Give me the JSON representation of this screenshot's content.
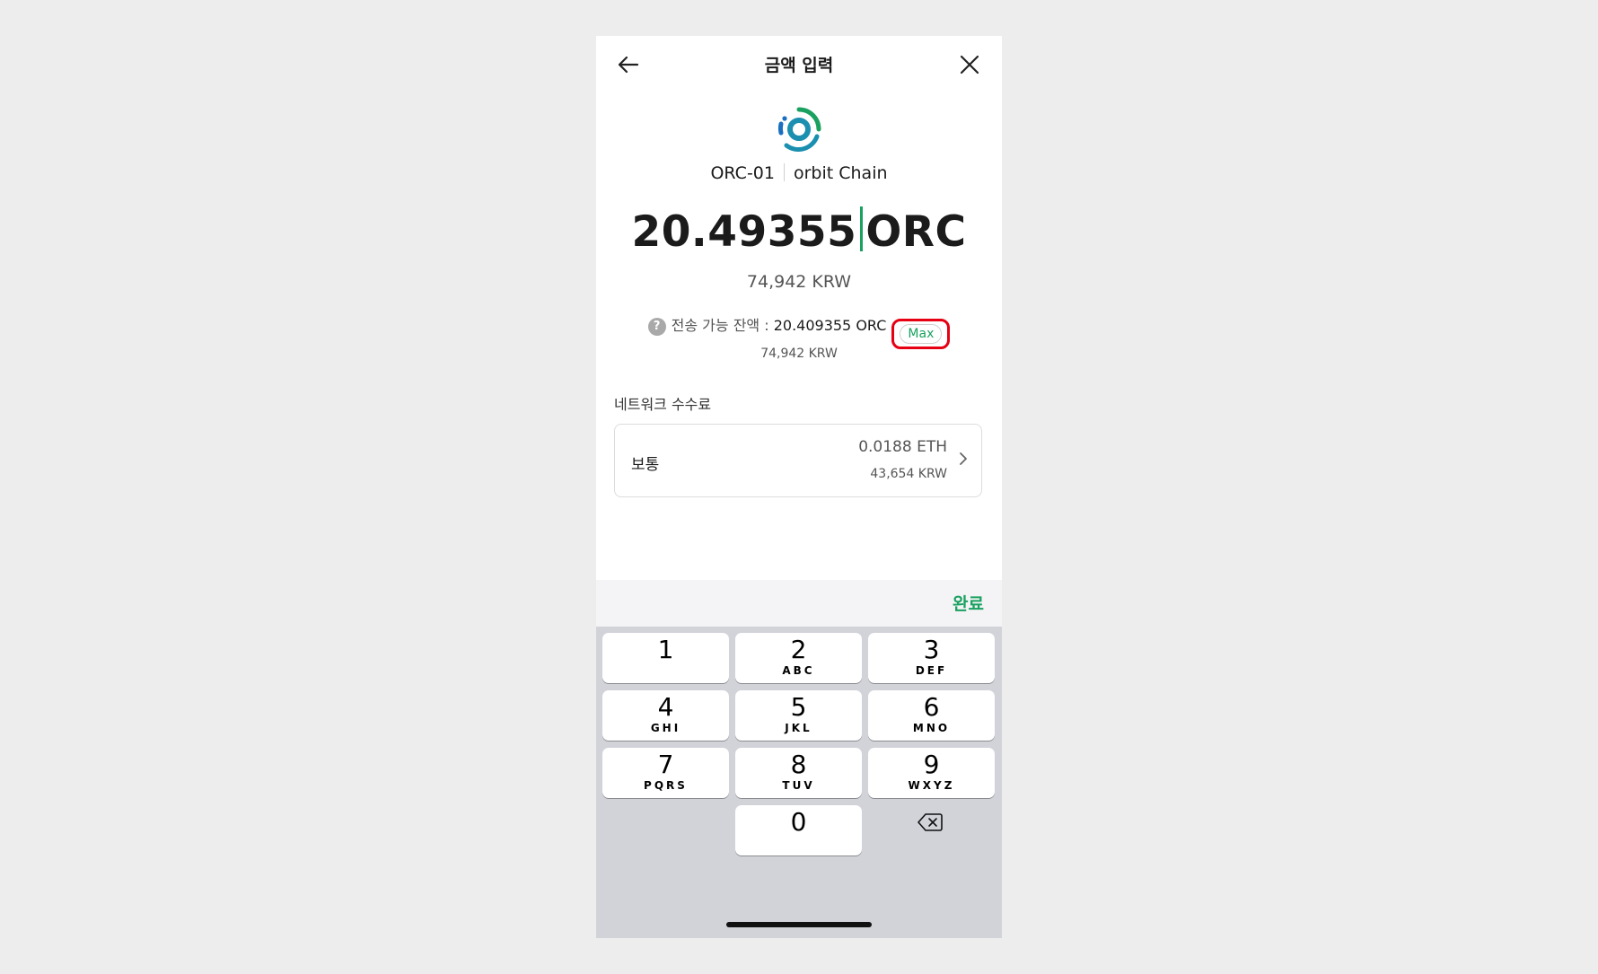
{
  "header": {
    "title": "금액 입력"
  },
  "token": {
    "symbol_name": "ORC-01",
    "chain": "orbit Chain"
  },
  "amount": {
    "value": "20.49355",
    "unit": "ORC",
    "krw": "74,942 KRW"
  },
  "available": {
    "help_glyph": "?",
    "label": "전송 가능 잔액 : ",
    "value": "20.409355 ORC",
    "max_label": "Max",
    "krw": "74,942 KRW"
  },
  "fee": {
    "title": "네트워크 수수료",
    "name": "보통",
    "eth": "0.0188 ETH",
    "krw": "43,654 KRW"
  },
  "keyboard": {
    "done_label": "완료",
    "keys": [
      {
        "num": "1",
        "letters": ""
      },
      {
        "num": "2",
        "letters": "ABC"
      },
      {
        "num": "3",
        "letters": "DEF"
      },
      {
        "num": "4",
        "letters": "GHI"
      },
      {
        "num": "5",
        "letters": "JKL"
      },
      {
        "num": "6",
        "letters": "MNO"
      },
      {
        "num": "7",
        "letters": "PQRS"
      },
      {
        "num": "8",
        "letters": "TUV"
      },
      {
        "num": "9",
        "letters": "WXYZ"
      },
      {
        "num": "0",
        "letters": ""
      }
    ]
  },
  "colors": {
    "accent": "#1aa160",
    "highlight": "#e60012",
    "keyboard_bg": "#d1d3d9"
  }
}
